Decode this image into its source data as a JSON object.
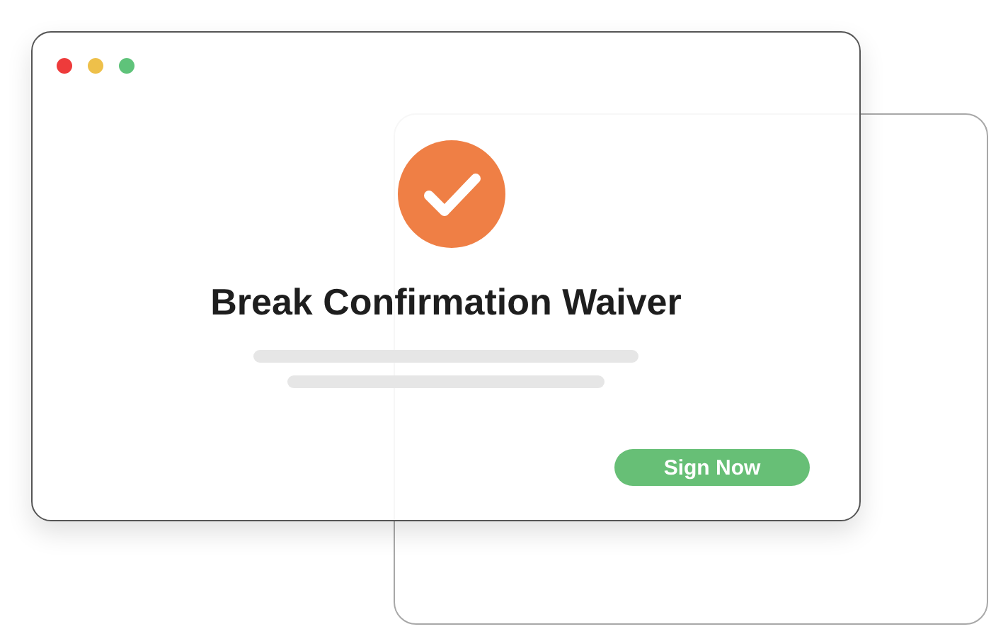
{
  "window": {
    "controls": [
      {
        "color": "#ee3b3b"
      },
      {
        "color": "#eec04a"
      },
      {
        "color": "#5fc37a"
      }
    ]
  },
  "dialog": {
    "title": "Break Confirmation Waiver",
    "button": "Sign Now"
  }
}
